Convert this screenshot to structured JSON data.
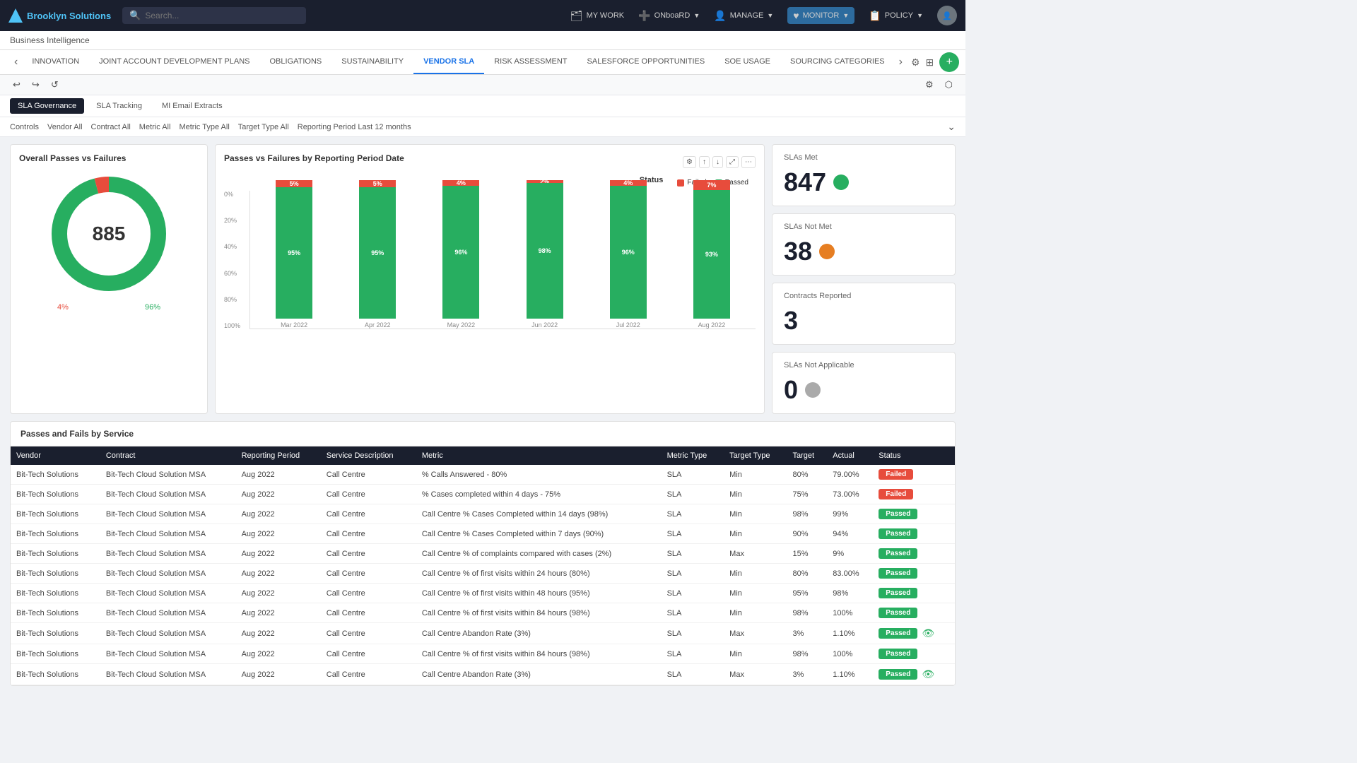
{
  "app": {
    "logo_text": "Brooklyn Solutions",
    "search_placeholder": "Search...",
    "nav_items": [
      {
        "id": "my-work",
        "label": "MY WORK",
        "icon": "🗂"
      },
      {
        "id": "onboard",
        "label": "ONBOARD",
        "icon": "➕"
      },
      {
        "id": "manage",
        "label": "MANAGE",
        "icon": "👤"
      },
      {
        "id": "monitor",
        "label": "MONITOR",
        "icon": "♥"
      },
      {
        "id": "policy",
        "label": "POLICY",
        "icon": "📋"
      }
    ]
  },
  "subtitle": "Business Intelligence",
  "tabs": [
    {
      "id": "innovation",
      "label": "INNOVATION"
    },
    {
      "id": "joint",
      "label": "JOINT ACCOUNT DEVELOPMENT PLANS"
    },
    {
      "id": "obligations",
      "label": "OBLIGATIONS"
    },
    {
      "id": "sustainability",
      "label": "SUSTAINABILITY"
    },
    {
      "id": "vendor-sla",
      "label": "VENDOR SLA",
      "active": true
    },
    {
      "id": "risk",
      "label": "RISK ASSESSMENT"
    },
    {
      "id": "salesforce",
      "label": "SALESFORCE OPPORTUNITIES"
    },
    {
      "id": "soe",
      "label": "SOE USAGE"
    },
    {
      "id": "sourcing",
      "label": "SOURCING CATEGORIES"
    }
  ],
  "filter_tabs": [
    {
      "label": "SLA Governance",
      "active": true
    },
    {
      "label": "SLA Tracking"
    },
    {
      "label": "MI Email Extracts"
    }
  ],
  "filter_pills": [
    {
      "label": "Controls"
    },
    {
      "label": "Vendor",
      "value": "All"
    },
    {
      "label": "Contract",
      "value": "All"
    },
    {
      "label": "Metric",
      "value": "All"
    },
    {
      "label": "Metric Type",
      "value": "All"
    },
    {
      "label": "Target Type",
      "value": "All"
    },
    {
      "label": "Reporting Period",
      "value": "Last 12 months"
    }
  ],
  "donut": {
    "title": "Overall Passes vs Failures",
    "total": "885",
    "pass_pct": "96%",
    "fail_pct": "4%",
    "pass_value": 849.6,
    "fail_value": 35.4,
    "circumference": 502.65
  },
  "bar_chart": {
    "title": "Passes vs Failures by Reporting Period Date",
    "status_label": "Status",
    "legend": [
      {
        "label": "Failed",
        "color": "#e74c3c"
      },
      {
        "label": "Passed",
        "color": "#27ae60"
      }
    ],
    "y_labels": [
      "0%",
      "20%",
      "40%",
      "60%",
      "80%",
      "100%"
    ],
    "bars": [
      {
        "period": "Mar 2022",
        "pass": 95,
        "fail": 5
      },
      {
        "period": "Apr 2022",
        "pass": 95,
        "fail": 5
      },
      {
        "period": "May 2022",
        "pass": 96,
        "fail": 4
      },
      {
        "period": "Jun 2022",
        "pass": 98,
        "fail": 2
      },
      {
        "period": "Jul 2022",
        "pass": 96,
        "fail": 4
      },
      {
        "period": "Aug 2022",
        "pass": 93,
        "fail": 7
      }
    ]
  },
  "stats": [
    {
      "id": "slas-met",
      "title": "SLAs Met",
      "value": "847",
      "dot": "green"
    },
    {
      "id": "slas-not-met",
      "title": "SLAs Not Met",
      "value": "38",
      "dot": "orange"
    },
    {
      "id": "contracts-reported",
      "title": "Contracts Reported",
      "value": "3",
      "dot": "none"
    },
    {
      "id": "slas-na",
      "title": "SLAs Not Applicable",
      "value": "0",
      "dot": "gray"
    }
  ],
  "table": {
    "title": "Passes and Fails by Service",
    "columns": [
      "Vendor",
      "Contract",
      "Reporting Period",
      "Service Description",
      "Metric",
      "Metric Type",
      "Target Type",
      "Target",
      "Actual",
      "Status"
    ],
    "rows": [
      {
        "vendor": "Bit-Tech Solutions",
        "contract": "Bit-Tech Cloud Solution MSA",
        "period": "Aug 2022",
        "service": "Call Centre",
        "metric": "% Calls Answered - 80%",
        "metric_type": "SLA",
        "target_type": "Min",
        "target": "80%",
        "actual": "79.00%",
        "status": "Failed"
      },
      {
        "vendor": "Bit-Tech Solutions",
        "contract": "Bit-Tech Cloud Solution MSA",
        "period": "Aug 2022",
        "service": "Call Centre",
        "metric": "% Cases completed within 4 days - 75%",
        "metric_type": "SLA",
        "target_type": "Min",
        "target": "75%",
        "actual": "73.00%",
        "status": "Failed"
      },
      {
        "vendor": "Bit-Tech Solutions",
        "contract": "Bit-Tech Cloud Solution MSA",
        "period": "Aug 2022",
        "service": "Call Centre",
        "metric": "Call Centre % Cases Completed within 14 days (98%)",
        "metric_type": "SLA",
        "target_type": "Min",
        "target": "98%",
        "actual": "99%",
        "status": "Passed"
      },
      {
        "vendor": "Bit-Tech Solutions",
        "contract": "Bit-Tech Cloud Solution MSA",
        "period": "Aug 2022",
        "service": "Call Centre",
        "metric": "Call Centre % Cases Completed within 7 days (90%)",
        "metric_type": "SLA",
        "target_type": "Min",
        "target": "90%",
        "actual": "94%",
        "status": "Passed"
      },
      {
        "vendor": "Bit-Tech Solutions",
        "contract": "Bit-Tech Cloud Solution MSA",
        "period": "Aug 2022",
        "service": "Call Centre",
        "metric": "Call Centre % of complaints compared with cases (2%)",
        "metric_type": "SLA",
        "target_type": "Max",
        "target": "15%",
        "actual": "9%",
        "status": "Passed"
      },
      {
        "vendor": "Bit-Tech Solutions",
        "contract": "Bit-Tech Cloud Solution MSA",
        "period": "Aug 2022",
        "service": "Call Centre",
        "metric": "Call Centre % of first visits within 24 hours (80%)",
        "metric_type": "SLA",
        "target_type": "Min",
        "target": "80%",
        "actual": "83.00%",
        "status": "Passed"
      },
      {
        "vendor": "Bit-Tech Solutions",
        "contract": "Bit-Tech Cloud Solution MSA",
        "period": "Aug 2022",
        "service": "Call Centre",
        "metric": "Call Centre % of first visits within 48 hours (95%)",
        "metric_type": "SLA",
        "target_type": "Min",
        "target": "95%",
        "actual": "98%",
        "status": "Passed"
      },
      {
        "vendor": "Bit-Tech Solutions",
        "contract": "Bit-Tech Cloud Solution MSA",
        "period": "Aug 2022",
        "service": "Call Centre",
        "metric": "Call Centre % of first visits within 84 hours (98%)",
        "metric_type": "SLA",
        "target_type": "Min",
        "target": "98%",
        "actual": "100%",
        "status": "Passed"
      },
      {
        "vendor": "Bit-Tech Solutions",
        "contract": "Bit-Tech Cloud Solution MSA",
        "period": "Aug 2022",
        "service": "Call Centre",
        "metric": "Call Centre Abandon Rate (3%)",
        "metric_type": "SLA",
        "target_type": "Max",
        "target": "3%",
        "actual": "1.10%",
        "status": "Passed",
        "eye": true
      },
      {
        "vendor": "Bit-Tech Solutions",
        "contract": "Bit-Tech Cloud Solution MSA",
        "period": "Aug 2022",
        "service": "Call Centre",
        "metric": "Call Centre % of first visits within 84 hours (98%)",
        "metric_type": "SLA",
        "target_type": "Min",
        "target": "98%",
        "actual": "100%",
        "status": "Passed"
      },
      {
        "vendor": "Bit-Tech Solutions",
        "contract": "Bit-Tech Cloud Solution MSA",
        "period": "Aug 2022",
        "service": "Call Centre",
        "metric": "Call Centre Abandon Rate (3%)",
        "metric_type": "SLA",
        "target_type": "Max",
        "target": "3%",
        "actual": "1.10%",
        "status": "Passed",
        "eye": true
      }
    ]
  }
}
